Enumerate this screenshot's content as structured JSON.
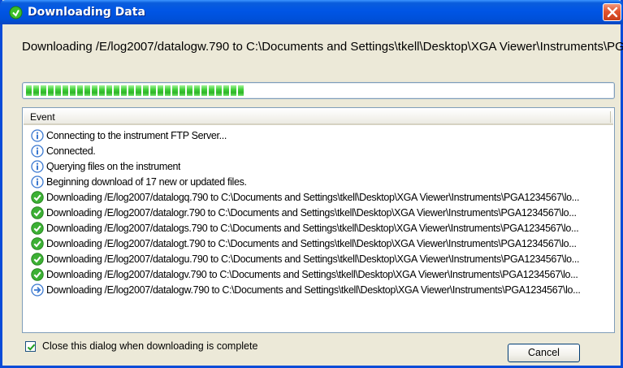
{
  "window": {
    "title": "Downloading Data"
  },
  "status_line": "Downloading /E/log2007/datalogw.790 to C:\\Documents and Settings\\tkell\\Desktop\\XGA Viewer\\Instruments\\PG",
  "progress": {
    "filled_chunks": 30,
    "fraction": 0.38,
    "color": "#2fb429"
  },
  "event_list": {
    "column_header": "Event",
    "rows": [
      {
        "icon": "info-icon",
        "text": "Connecting to the instrument FTP Server..."
      },
      {
        "icon": "info-icon",
        "text": "Connected."
      },
      {
        "icon": "info-icon",
        "text": "Querying files on the instrument"
      },
      {
        "icon": "info-icon",
        "text": "Beginning download of 17 new or updated files."
      },
      {
        "icon": "check-icon",
        "text": "Downloading /E/log2007/datalogq.790 to C:\\Documents and Settings\\tkell\\Desktop\\XGA Viewer\\Instruments\\PGA1234567\\lo..."
      },
      {
        "icon": "check-icon",
        "text": "Downloading /E/log2007/datalogr.790 to C:\\Documents and Settings\\tkell\\Desktop\\XGA Viewer\\Instruments\\PGA1234567\\lo..."
      },
      {
        "icon": "check-icon",
        "text": "Downloading /E/log2007/datalogs.790 to C:\\Documents and Settings\\tkell\\Desktop\\XGA Viewer\\Instruments\\PGA1234567\\lo..."
      },
      {
        "icon": "check-icon",
        "text": "Downloading /E/log2007/datalogt.790 to C:\\Documents and Settings\\tkell\\Desktop\\XGA Viewer\\Instruments\\PGA1234567\\lo..."
      },
      {
        "icon": "check-icon",
        "text": "Downloading /E/log2007/datalogu.790 to C:\\Documents and Settings\\tkell\\Desktop\\XGA Viewer\\Instruments\\PGA1234567\\lo..."
      },
      {
        "icon": "check-icon",
        "text": "Downloading /E/log2007/datalogv.790 to C:\\Documents and Settings\\tkell\\Desktop\\XGA Viewer\\Instruments\\PGA1234567\\lo..."
      },
      {
        "icon": "arrow-right-icon",
        "text": "Downloading /E/log2007/datalogw.790 to C:\\Documents and Settings\\tkell\\Desktop\\XGA Viewer\\Instruments\\PGA1234567\\lo..."
      }
    ]
  },
  "close_when_complete": {
    "label": "Close this dialog when downloading is complete",
    "checked": true
  },
  "buttons": {
    "cancel_label": "Cancel"
  },
  "colors": {
    "titlebar": "#0055e5",
    "dialog_background": "#ece9d8",
    "close_button": "#e2542e",
    "info_icon": "#3a78d0",
    "check_icon": "#3cb034",
    "arrow_icon": "#3a78d0"
  }
}
